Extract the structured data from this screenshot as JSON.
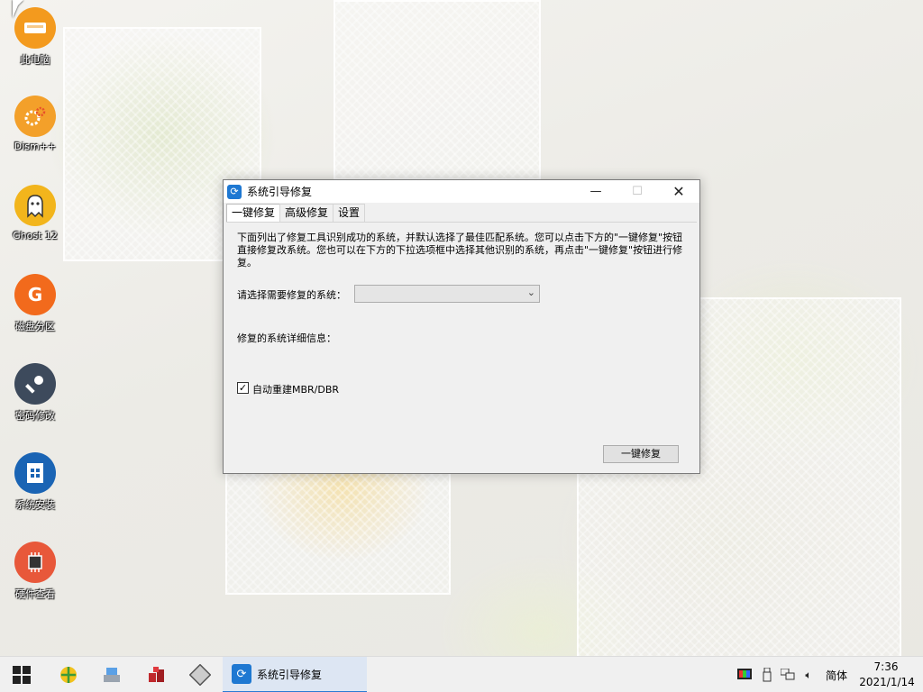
{
  "desktop": {
    "icons": [
      {
        "label": "此电脑",
        "icon": "computer-icon",
        "color": "#f39a1e"
      },
      {
        "label": "Dism++",
        "icon": "gears-icon",
        "color": "#f3a02a"
      },
      {
        "label": "Ghost 12",
        "icon": "ghost-icon",
        "color": "#f2b51c"
      },
      {
        "label": "磁盘分区",
        "icon": "partition-icon",
        "color": "#f26a1c"
      },
      {
        "label": "密码修改",
        "icon": "key-icon",
        "color": "#3d4a5c"
      },
      {
        "label": "系统安装",
        "icon": "install-icon",
        "color": "#1a64b4"
      },
      {
        "label": "硬件查看",
        "icon": "chip-icon",
        "color": "#e8583a"
      }
    ]
  },
  "window": {
    "title": "系统引导修复",
    "tabs": [
      {
        "label": "一键修复",
        "active": true
      },
      {
        "label": "高级修复",
        "active": false
      },
      {
        "label": "设置",
        "active": false
      }
    ],
    "description": "下面列出了修复工具识别成功的系统，并默认选择了最佳匹配系统。您可以点击下方的\"一键修复\"按钮直接修复改系统。您也可以在下方的下拉选项框中选择其他识别的系统，再点击\"一键修复\"按钮进行修复。",
    "select_label": "请选择需要修复的系统：",
    "select_value": "",
    "detail_label": "修复的系统详细信息：",
    "checkbox_label": "自动重建MBR/DBR",
    "checkbox_checked": true,
    "repair_button": "一键修复"
  },
  "taskbar": {
    "active_app": "系统引导修复",
    "ime": "简体",
    "time": "7:36",
    "date": "2021/1/14"
  },
  "colors": {
    "accent": "#2a7bd4",
    "taskbar_bg": "#f0f0f0",
    "window_bg": "#f0f0f0"
  }
}
